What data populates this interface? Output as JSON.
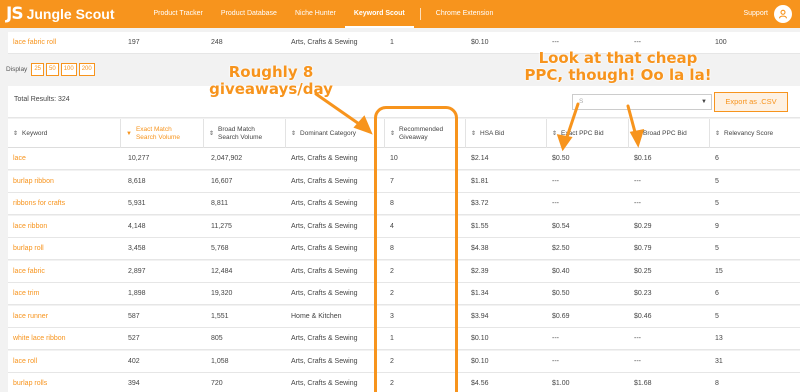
{
  "brand": {
    "name": "Jungle Scout",
    "mark": "JS"
  },
  "nav": {
    "items": [
      "Product Tracker",
      "Product Database",
      "Niche Hunter",
      "Keyword Scout",
      "Chrome Extension"
    ],
    "support": "Support"
  },
  "top_row": {
    "keyword": "lace fabric roll",
    "exact": "197",
    "broad": "248",
    "category": "Arts, Crafts & Sewing",
    "giveaway": "1",
    "hsa": "$0.10",
    "exact_ppc": "---",
    "broad_ppc": "---",
    "relevancy": "100"
  },
  "display": {
    "label": "Display",
    "options": [
      "25",
      "50",
      "100",
      "200"
    ]
  },
  "results": {
    "total": "Total Results: 324",
    "filter_placeholder": "S",
    "export_label": "Export as .CSV"
  },
  "columns": {
    "keyword": "Keyword",
    "exact": "Exact Match Search Volume",
    "broad": "Broad Match Search Volume",
    "category": "Dominant Category",
    "giveaway": "Recommended Giveaway",
    "hsa": "HSA Bid",
    "exact_ppc": "Exact PPC Bid",
    "broad_ppc": "Broad PPC Bid",
    "relevancy": "Relevancy Score"
  },
  "rows": [
    {
      "keyword": "lace",
      "exact": "10,277",
      "broad": "2,047,902",
      "category": "Arts, Crafts & Sewing",
      "giveaway": "10",
      "hsa": "$2.14",
      "exact_ppc": "$0.50",
      "broad_ppc": "$0.16",
      "relevancy": "6"
    },
    {
      "keyword": "burlap ribbon",
      "exact": "8,618",
      "broad": "16,607",
      "category": "Arts, Crafts & Sewing",
      "giveaway": "7",
      "hsa": "$1.81",
      "exact_ppc": "---",
      "broad_ppc": "---",
      "relevancy": "5"
    },
    {
      "keyword": "ribbons for crafts",
      "exact": "5,931",
      "broad": "8,811",
      "category": "Arts, Crafts & Sewing",
      "giveaway": "8",
      "hsa": "$3.72",
      "exact_ppc": "---",
      "broad_ppc": "---",
      "relevancy": "5"
    },
    {
      "keyword": "lace ribbon",
      "exact": "4,148",
      "broad": "11,275",
      "category": "Arts, Crafts & Sewing",
      "giveaway": "4",
      "hsa": "$1.55",
      "exact_ppc": "$0.54",
      "broad_ppc": "$0.29",
      "relevancy": "9"
    },
    {
      "keyword": "burlap roll",
      "exact": "3,458",
      "broad": "5,768",
      "category": "Arts, Crafts & Sewing",
      "giveaway": "8",
      "hsa": "$4.38",
      "exact_ppc": "$2.50",
      "broad_ppc": "$0.79",
      "relevancy": "5"
    },
    {
      "keyword": "lace fabric",
      "exact": "2,897",
      "broad": "12,484",
      "category": "Arts, Crafts & Sewing",
      "giveaway": "2",
      "hsa": "$2.39",
      "exact_ppc": "$0.40",
      "broad_ppc": "$0.25",
      "relevancy": "15"
    },
    {
      "keyword": "lace trim",
      "exact": "1,898",
      "broad": "19,320",
      "category": "Arts, Crafts & Sewing",
      "giveaway": "2",
      "hsa": "$1.34",
      "exact_ppc": "$0.50",
      "broad_ppc": "$0.23",
      "relevancy": "6"
    },
    {
      "keyword": "lace runner",
      "exact": "587",
      "broad": "1,551",
      "category": "Home & Kitchen",
      "giveaway": "3",
      "hsa": "$3.94",
      "exact_ppc": "$0.69",
      "broad_ppc": "$0.46",
      "relevancy": "5"
    },
    {
      "keyword": "white lace ribbon",
      "exact": "527",
      "broad": "805",
      "category": "Arts, Crafts & Sewing",
      "giveaway": "1",
      "hsa": "$0.10",
      "exact_ppc": "---",
      "broad_ppc": "---",
      "relevancy": "13"
    },
    {
      "keyword": "lace roll",
      "exact": "402",
      "broad": "1,058",
      "category": "Arts, Crafts & Sewing",
      "giveaway": "2",
      "hsa": "$0.10",
      "exact_ppc": "---",
      "broad_ppc": "---",
      "relevancy": "31"
    },
    {
      "keyword": "burlap rolls",
      "exact": "394",
      "broad": "720",
      "category": "Arts, Crafts & Sewing",
      "giveaway": "2",
      "hsa": "$4.56",
      "exact_ppc": "$1.00",
      "broad_ppc": "$1.68",
      "relevancy": "8"
    }
  ],
  "annotations": {
    "giveaways": "Roughly 8 giveaways/day",
    "ppc": "Look at that cheap PPC, though! Oo la la!"
  },
  "colors": {
    "accent": "#f7941d",
    "background": "#f2f2f2"
  }
}
